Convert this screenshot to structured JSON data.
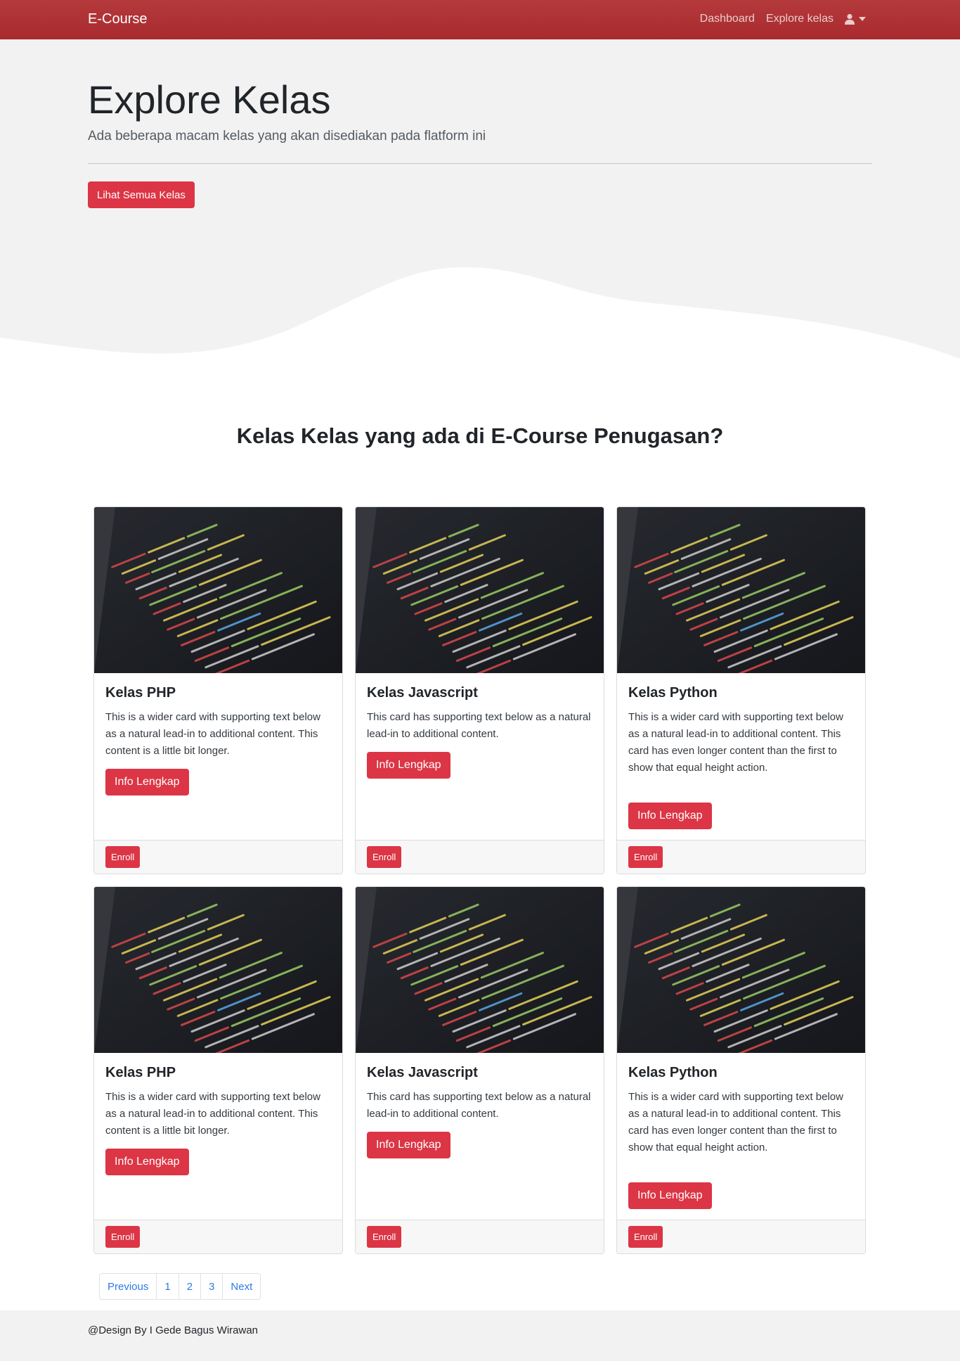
{
  "navbar": {
    "brand": "E-Course",
    "links": [
      "Dashboard",
      "Explore kelas"
    ],
    "user_icon": "user-icon",
    "caret_icon": "caret-down-icon"
  },
  "hero": {
    "title": "Explore Kelas",
    "lead": "Ada beberapa macam kelas yang akan disediakan pada flatform ini",
    "button": "Lihat Semua Kelas"
  },
  "section": {
    "title": "Kelas Kelas yang ada di E-Course Penugasan?"
  },
  "cards": [
    {
      "title": "Kelas PHP",
      "text": "This is a wider card with supporting text below as a natural lead-in to additional content. This content is a little bit longer.",
      "button": "Info Lengkap",
      "footer_button": "Enroll"
    },
    {
      "title": "Kelas Javascript",
      "text": "This card has supporting text below as a natural lead-in to additional content.",
      "button": "Info Lengkap",
      "footer_button": "Enroll"
    },
    {
      "title": "Kelas Python",
      "text": "This is a wider card with supporting text below as a natural lead-in to additional content. This card has even longer content than the first to show that equal height action.",
      "button": "Info Lengkap",
      "footer_button": "Enroll"
    },
    {
      "title": "Kelas PHP",
      "text": "This is a wider card with supporting text below as a natural lead-in to additional content. This content is a little bit longer.",
      "button": "Info Lengkap",
      "footer_button": "Enroll"
    },
    {
      "title": "Kelas Javascript",
      "text": "This card has supporting text below as a natural lead-in to additional content.",
      "button": "Info Lengkap",
      "footer_button": "Enroll"
    },
    {
      "title": "Kelas Python",
      "text": "This is a wider card with supporting text below as a natural lead-in to additional content. This card has even longer content than the first to show that equal height action.",
      "button": "Info Lengkap",
      "footer_button": "Enroll"
    }
  ],
  "pagination": {
    "previous": "Previous",
    "pages": [
      "1",
      "2",
      "3"
    ],
    "next": "Next"
  },
  "footer": {
    "text": "@Design By I Gede Bagus Wirawan"
  },
  "colors": {
    "navbar": "#a82a2e",
    "accent": "#dc3545",
    "link": "#2f7ae5",
    "hero_bg": "#f2f2f2"
  }
}
